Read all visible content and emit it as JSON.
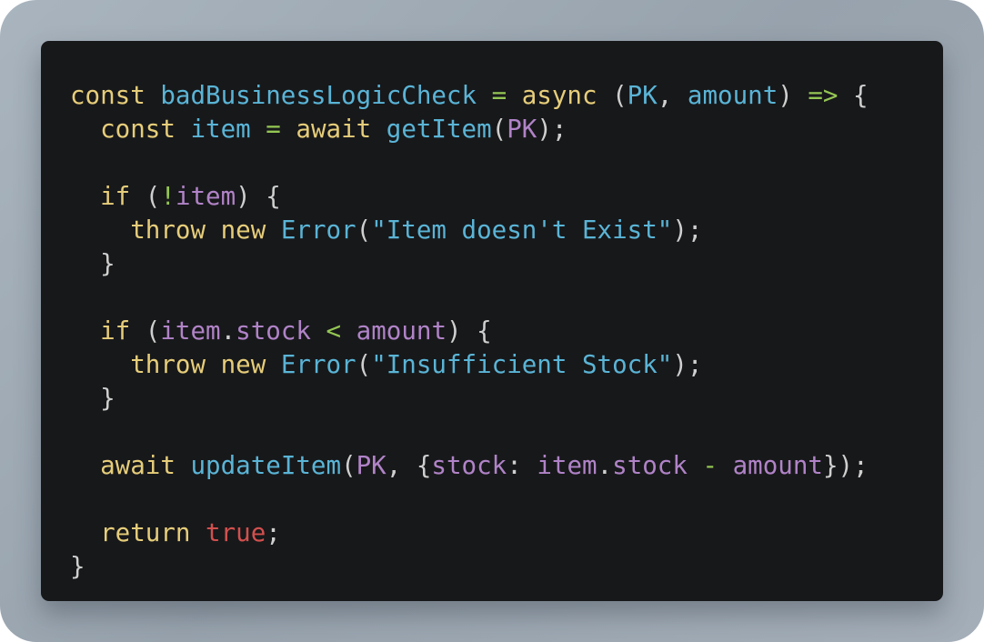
{
  "colors": {
    "background_frame": "#a0abb5",
    "code_background": "#17181a",
    "keyword": "#e6cd7a",
    "function": "#5ab4d6",
    "operator": "#94c654",
    "punctuation": "#cfcfcf",
    "property": "#b083c7",
    "string": "#5ab4d6",
    "boolean": "#d2504e"
  },
  "code": {
    "language": "javascript",
    "lines": [
      {
        "tokens": [
          {
            "t": "const",
            "c": "kw"
          },
          {
            "t": " ",
            "c": "pu"
          },
          {
            "t": "badBusinessLogicCheck",
            "c": "fn"
          },
          {
            "t": " ",
            "c": "pu"
          },
          {
            "t": "=",
            "c": "op"
          },
          {
            "t": " ",
            "c": "pu"
          },
          {
            "t": "async",
            "c": "kw"
          },
          {
            "t": " (",
            "c": "pu"
          },
          {
            "t": "PK",
            "c": "fn"
          },
          {
            "t": ", ",
            "c": "pu"
          },
          {
            "t": "amount",
            "c": "fn"
          },
          {
            "t": ") ",
            "c": "pu"
          },
          {
            "t": "=>",
            "c": "op"
          },
          {
            "t": " {",
            "c": "pu"
          }
        ]
      },
      {
        "tokens": [
          {
            "t": "  ",
            "c": "pu"
          },
          {
            "t": "const",
            "c": "kw"
          },
          {
            "t": " ",
            "c": "pu"
          },
          {
            "t": "item",
            "c": "fn"
          },
          {
            "t": " ",
            "c": "pu"
          },
          {
            "t": "=",
            "c": "op"
          },
          {
            "t": " ",
            "c": "pu"
          },
          {
            "t": "await",
            "c": "kw"
          },
          {
            "t": " ",
            "c": "pu"
          },
          {
            "t": "getItem",
            "c": "fn"
          },
          {
            "t": "(",
            "c": "pu"
          },
          {
            "t": "PK",
            "c": "pr"
          },
          {
            "t": ");",
            "c": "pu"
          }
        ]
      },
      {
        "tokens": []
      },
      {
        "tokens": [
          {
            "t": "  ",
            "c": "pu"
          },
          {
            "t": "if",
            "c": "kw"
          },
          {
            "t": " (",
            "c": "pu"
          },
          {
            "t": "!",
            "c": "op"
          },
          {
            "t": "item",
            "c": "pr"
          },
          {
            "t": ") {",
            "c": "pu"
          }
        ]
      },
      {
        "tokens": [
          {
            "t": "    ",
            "c": "pu"
          },
          {
            "t": "throw",
            "c": "kw"
          },
          {
            "t": " ",
            "c": "pu"
          },
          {
            "t": "new",
            "c": "kw"
          },
          {
            "t": " ",
            "c": "pu"
          },
          {
            "t": "Error",
            "c": "fn"
          },
          {
            "t": "(",
            "c": "pu"
          },
          {
            "t": "\"Item doesn't Exist\"",
            "c": "str"
          },
          {
            "t": ");",
            "c": "pu"
          }
        ]
      },
      {
        "tokens": [
          {
            "t": "  }",
            "c": "pu"
          }
        ]
      },
      {
        "tokens": []
      },
      {
        "tokens": [
          {
            "t": "  ",
            "c": "pu"
          },
          {
            "t": "if",
            "c": "kw"
          },
          {
            "t": " (",
            "c": "pu"
          },
          {
            "t": "item",
            "c": "pr"
          },
          {
            "t": ".",
            "c": "pu"
          },
          {
            "t": "stock",
            "c": "pr"
          },
          {
            "t": " ",
            "c": "pu"
          },
          {
            "t": "<",
            "c": "op"
          },
          {
            "t": " ",
            "c": "pu"
          },
          {
            "t": "amount",
            "c": "pr"
          },
          {
            "t": ") {",
            "c": "pu"
          }
        ]
      },
      {
        "tokens": [
          {
            "t": "    ",
            "c": "pu"
          },
          {
            "t": "throw",
            "c": "kw"
          },
          {
            "t": " ",
            "c": "pu"
          },
          {
            "t": "new",
            "c": "kw"
          },
          {
            "t": " ",
            "c": "pu"
          },
          {
            "t": "Error",
            "c": "fn"
          },
          {
            "t": "(",
            "c": "pu"
          },
          {
            "t": "\"Insufficient Stock\"",
            "c": "str"
          },
          {
            "t": ");",
            "c": "pu"
          }
        ]
      },
      {
        "tokens": [
          {
            "t": "  }",
            "c": "pu"
          }
        ]
      },
      {
        "tokens": []
      },
      {
        "tokens": [
          {
            "t": "  ",
            "c": "pu"
          },
          {
            "t": "await",
            "c": "kw"
          },
          {
            "t": " ",
            "c": "pu"
          },
          {
            "t": "updateItem",
            "c": "fn"
          },
          {
            "t": "(",
            "c": "pu"
          },
          {
            "t": "PK",
            "c": "pr"
          },
          {
            "t": ", {",
            "c": "pu"
          },
          {
            "t": "stock",
            "c": "pr"
          },
          {
            "t": ": ",
            "c": "pu"
          },
          {
            "t": "item",
            "c": "pr"
          },
          {
            "t": ".",
            "c": "pu"
          },
          {
            "t": "stock",
            "c": "pr"
          },
          {
            "t": " ",
            "c": "pu"
          },
          {
            "t": "-",
            "c": "op"
          },
          {
            "t": " ",
            "c": "pu"
          },
          {
            "t": "amount",
            "c": "pr"
          },
          {
            "t": "});",
            "c": "pu"
          }
        ]
      },
      {
        "tokens": []
      },
      {
        "tokens": [
          {
            "t": "  ",
            "c": "pu"
          },
          {
            "t": "return",
            "c": "kw"
          },
          {
            "t": " ",
            "c": "pu"
          },
          {
            "t": "true",
            "c": "bool"
          },
          {
            "t": ";",
            "c": "pu"
          }
        ]
      },
      {
        "tokens": [
          {
            "t": "}",
            "c": "pu"
          }
        ]
      }
    ]
  }
}
